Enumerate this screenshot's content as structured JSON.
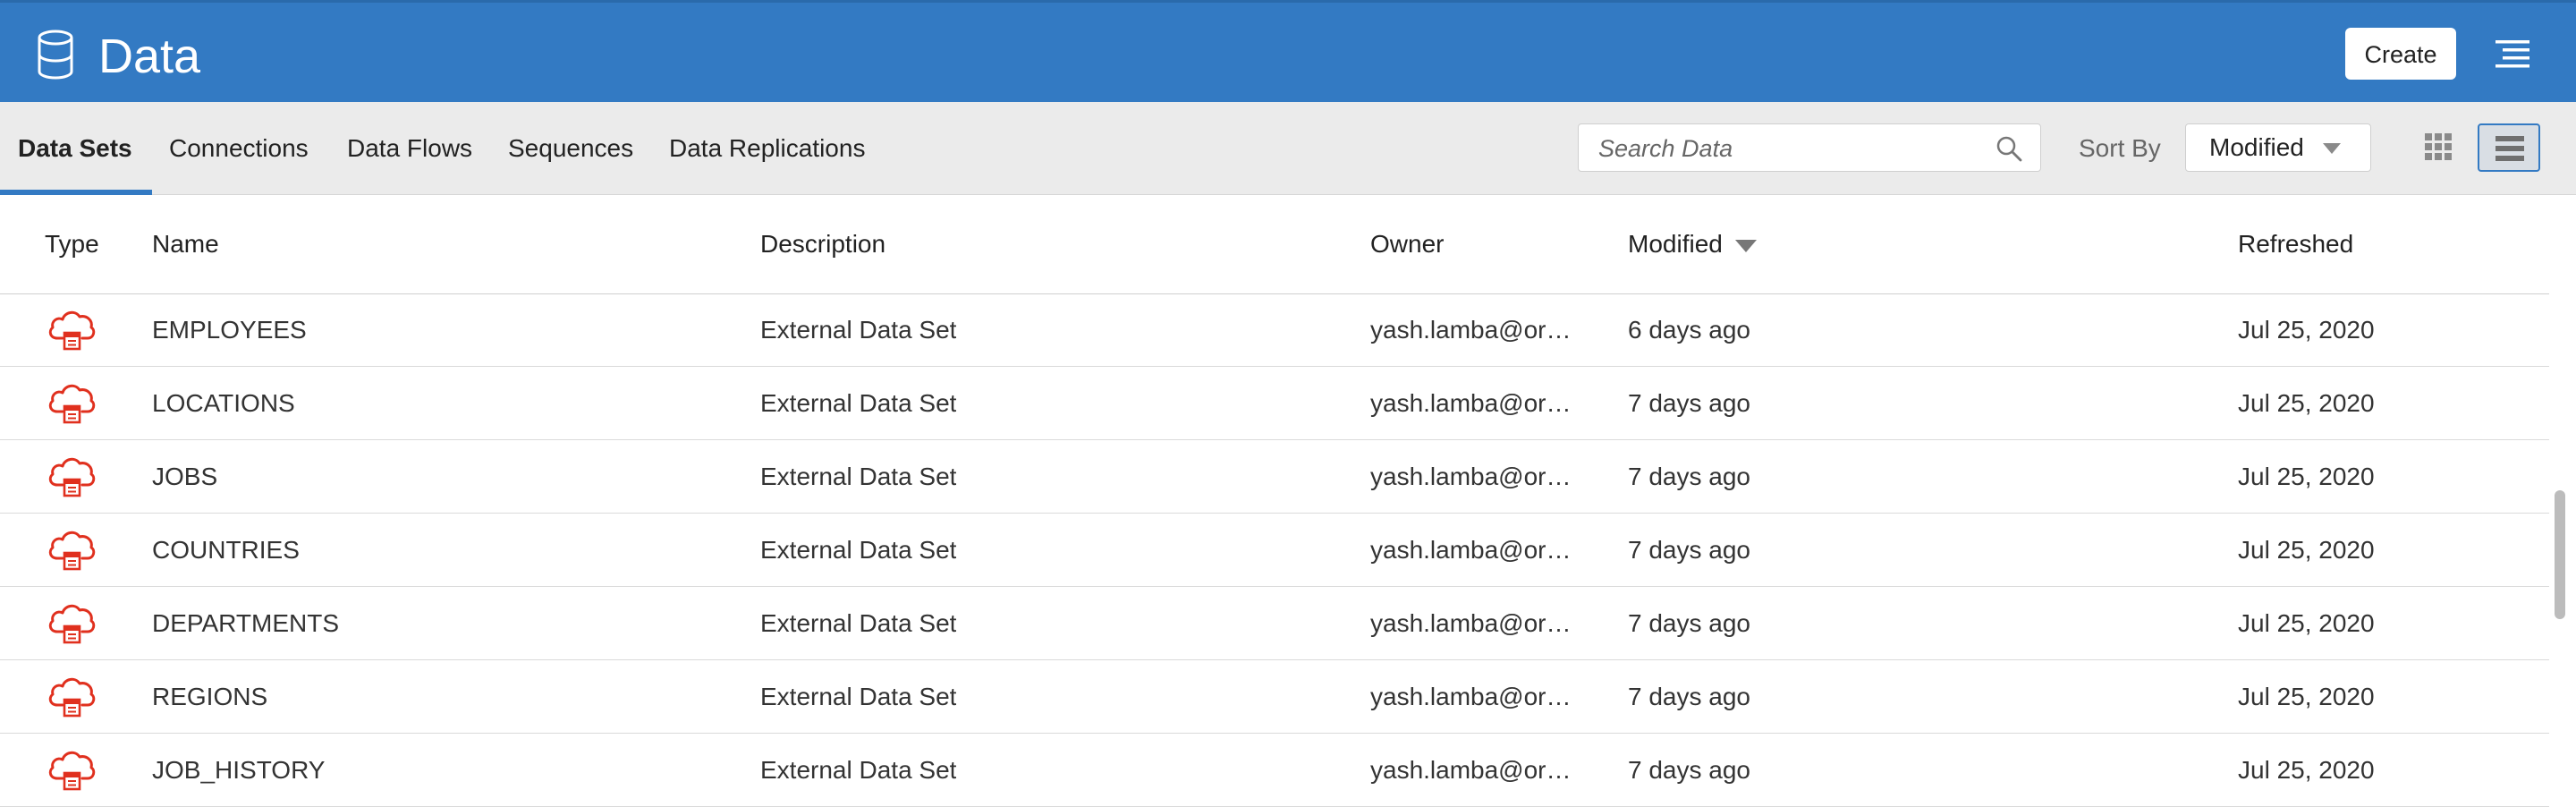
{
  "header": {
    "title": "Data",
    "create_label": "Create",
    "icon": "database-icon",
    "menu_icon": "hamburger-menu-icon"
  },
  "tabs": [
    {
      "label": "Data Sets",
      "active": true
    },
    {
      "label": "Connections",
      "active": false
    },
    {
      "label": "Data Flows",
      "active": false
    },
    {
      "label": "Sequences",
      "active": false
    },
    {
      "label": "Data Replications",
      "active": false
    }
  ],
  "search": {
    "placeholder": "Search Data",
    "value": ""
  },
  "sort": {
    "label": "Sort By",
    "value": "Modified"
  },
  "view_toggle": {
    "selected": "list"
  },
  "table": {
    "columns": {
      "type": "Type",
      "name": "Name",
      "description": "Description",
      "owner": "Owner",
      "modified": "Modified",
      "refreshed": "Refreshed"
    },
    "sorted_column": "Modified",
    "sort_direction": "descending",
    "rows": [
      {
        "name": "EMPLOYEES",
        "description": "External Data Set",
        "owner": "yash.lamba@ora…",
        "modified": "6 days ago",
        "refreshed": "Jul 25, 2020"
      },
      {
        "name": "LOCATIONS",
        "description": "External Data Set",
        "owner": "yash.lamba@ora…",
        "modified": "7 days ago",
        "refreshed": "Jul 25, 2020"
      },
      {
        "name": "JOBS",
        "description": "External Data Set",
        "owner": "yash.lamba@ora…",
        "modified": "7 days ago",
        "refreshed": "Jul 25, 2020"
      },
      {
        "name": "COUNTRIES",
        "description": "External Data Set",
        "owner": "yash.lamba@ora…",
        "modified": "7 days ago",
        "refreshed": "Jul 25, 2020"
      },
      {
        "name": "DEPARTMENTS",
        "description": "External Data Set",
        "owner": "yash.lamba@ora…",
        "modified": "7 days ago",
        "refreshed": "Jul 25, 2020"
      },
      {
        "name": "REGIONS",
        "description": "External Data Set",
        "owner": "yash.lamba@ora…",
        "modified": "7 days ago",
        "refreshed": "Jul 25, 2020"
      },
      {
        "name": "JOB_HISTORY",
        "description": "External Data Set",
        "owner": "yash.lamba@ora…",
        "modified": "7 days ago",
        "refreshed": "Jul 25, 2020"
      }
    ],
    "row_icon": "external-data-set-cloud-icon"
  },
  "colors": {
    "header_bg": "#337ac3",
    "toolbar_bg": "#ebebeb",
    "accent": "#337ac3",
    "row_icon": "#e0301e"
  }
}
